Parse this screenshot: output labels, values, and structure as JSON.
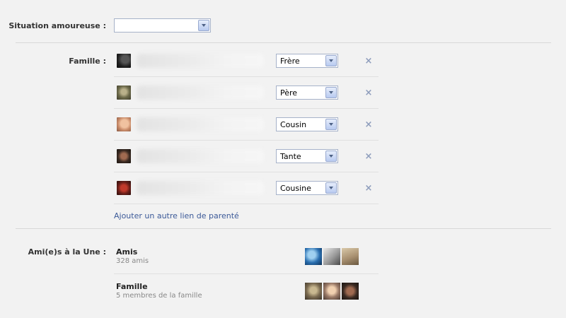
{
  "relationship": {
    "label": "Situation amoureuse :",
    "value": ""
  },
  "family": {
    "label": "Famille :",
    "members": [
      {
        "relation": "Frère"
      },
      {
        "relation": "Père"
      },
      {
        "relation": "Cousin"
      },
      {
        "relation": "Tante"
      },
      {
        "relation": "Cousine"
      }
    ],
    "remove_glyph": "×",
    "add_link": "Ajouter un autre lien de parenté"
  },
  "featured": {
    "label": "Ami(e)s à la Une :",
    "lists": [
      {
        "title": "Amis",
        "subtitle": "328 amis"
      },
      {
        "title": "Famille",
        "subtitle": "5 membres de la famille"
      }
    ]
  },
  "colors": {
    "background": "#f2f2f2",
    "link": "#3b5998",
    "select_border": "#a6b2c9"
  }
}
